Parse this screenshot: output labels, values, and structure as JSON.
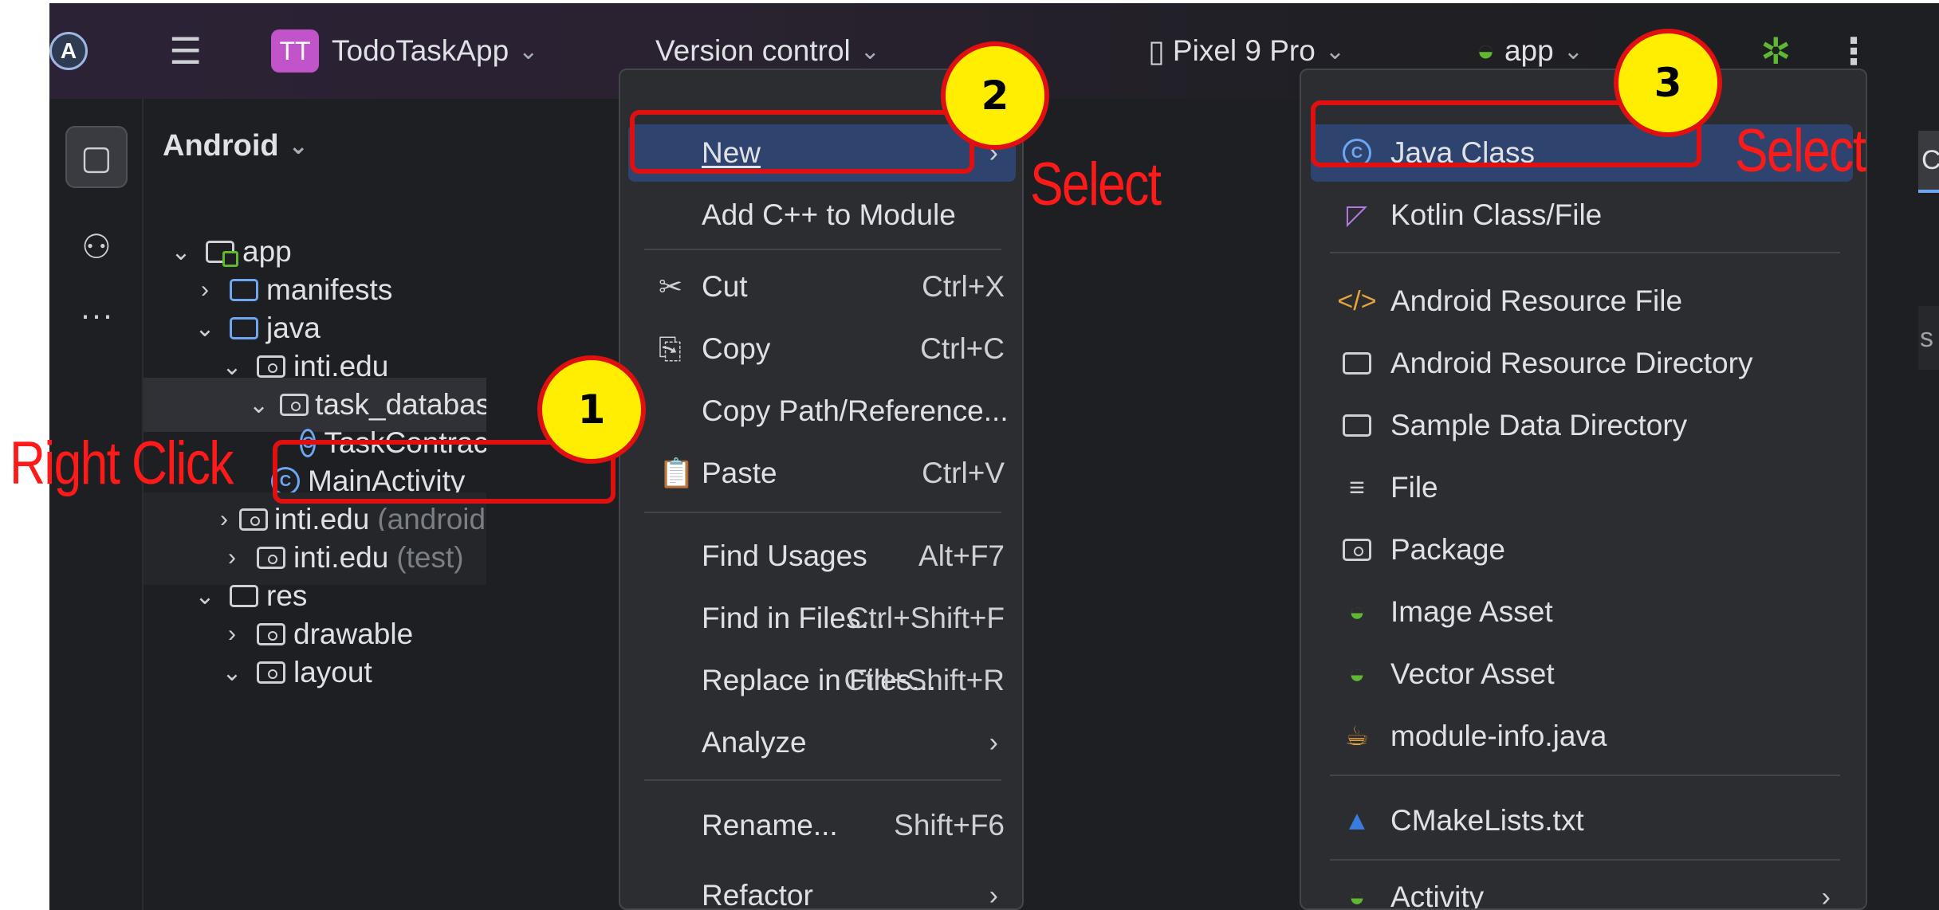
{
  "toolbar": {
    "project_badge": "TT",
    "project_name": "TodoTaskApp",
    "vcs": "Version control",
    "device": "Pixel 9 Pro",
    "run_config": "app"
  },
  "project_panel": {
    "view": "Android",
    "tree": [
      {
        "label": "app",
        "suffix": ""
      },
      {
        "label": "manifests",
        "suffix": ""
      },
      {
        "label": "java",
        "suffix": ""
      },
      {
        "label": "inti.edu",
        "suffix": ""
      },
      {
        "label": "task_database",
        "suffix": ""
      },
      {
        "label": "TaskContract",
        "suffix": ""
      },
      {
        "label": "MainActivity",
        "suffix": ""
      },
      {
        "label": "inti.edu",
        "suffix": "(androidTest)"
      },
      {
        "label": "inti.edu",
        "suffix": "(test)"
      },
      {
        "label": "res",
        "suffix": ""
      },
      {
        "label": "drawable",
        "suffix": ""
      },
      {
        "label": "layout",
        "suffix": ""
      }
    ]
  },
  "context_menu": {
    "items": [
      {
        "label": "New",
        "shortcut": ""
      },
      {
        "label": "Add C++ to Module",
        "shortcut": ""
      },
      {
        "label": "Cut",
        "shortcut": "Ctrl+X"
      },
      {
        "label": "Copy",
        "shortcut": "Ctrl+C"
      },
      {
        "label": "Copy Path/Reference...",
        "shortcut": ""
      },
      {
        "label": "Paste",
        "shortcut": "Ctrl+V"
      },
      {
        "label": "Find Usages",
        "shortcut": "Alt+F7"
      },
      {
        "label": "Find in Files...",
        "shortcut": "Ctrl+Shift+F"
      },
      {
        "label": "Replace in Files...",
        "shortcut": "Ctrl+Shift+R"
      },
      {
        "label": "Analyze",
        "shortcut": ""
      },
      {
        "label": "Rename...",
        "shortcut": "Shift+F6"
      },
      {
        "label": "Refactor",
        "shortcut": ""
      }
    ]
  },
  "new_submenu": {
    "items": [
      {
        "label": "Java Class"
      },
      {
        "label": "Kotlin Class/File"
      },
      {
        "label": "Android Resource File"
      },
      {
        "label": "Android Resource Directory"
      },
      {
        "label": "Sample Data Directory"
      },
      {
        "label": "File"
      },
      {
        "label": "Package"
      },
      {
        "label": "Image Asset"
      },
      {
        "label": "Vector Asset"
      },
      {
        "label": "module-info.java"
      },
      {
        "label": "CMakeLists.txt"
      },
      {
        "label": "Activity"
      }
    ]
  },
  "editor": {
    "tab_fragment": "Cont",
    "field_fragment": "s"
  },
  "annotations": {
    "step1": "1",
    "step2": "2",
    "step3": "3",
    "right_click": "Right Click",
    "select_new": "Select",
    "select_java": "Select"
  },
  "colors": {
    "annotation_red": "#e01010",
    "badge_yellow": "#ffee00",
    "menu_highlight": "#2e436e",
    "ide_background": "#1e1f22"
  }
}
